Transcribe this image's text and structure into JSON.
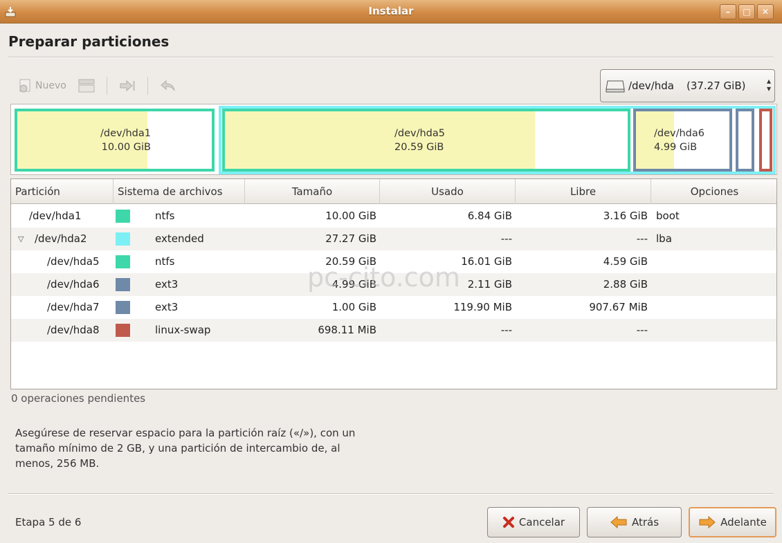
{
  "window": {
    "title": "Instalar"
  },
  "page": {
    "title": "Preparar particiones"
  },
  "toolbar": {
    "new_label": "Nuevo"
  },
  "disk": {
    "name": "/dev/hda",
    "size": "(37.27 GiB)"
  },
  "partition_bar": [
    {
      "name": "/dev/hda1",
      "size": "10.00 GiB"
    },
    {
      "name": "/dev/hda5",
      "size": "20.59 GiB"
    },
    {
      "name": "/dev/hda6",
      "size": "4.99 GiB"
    }
  ],
  "table": {
    "headers": [
      "Partición",
      "Sistema de archivos",
      "Tamaño",
      "Usado",
      "Libre",
      "Opciones"
    ],
    "rows": [
      {
        "partition": "/dev/hda1",
        "fs": "ntfs",
        "size": "10.00 GiB",
        "used": "6.84 GiB",
        "free": "3.16 GiB",
        "options": "boot",
        "color": "#3ed7a9"
      },
      {
        "partition": "/dev/hda2",
        "fs": "extended",
        "size": "27.27 GiB",
        "used": "---",
        "free": "---",
        "options": "lba",
        "color": "#7cf0f5"
      },
      {
        "partition": "/dev/hda5",
        "fs": "ntfs",
        "size": "20.59 GiB",
        "used": "16.01 GiB",
        "free": "4.59 GiB",
        "options": "",
        "color": "#3ed7a9"
      },
      {
        "partition": "/dev/hda6",
        "fs": "ext3",
        "size": "4.99 GiB",
        "used": "2.11 GiB",
        "free": "2.88 GiB",
        "options": "",
        "color": "#6f89a8"
      },
      {
        "partition": "/dev/hda7",
        "fs": "ext3",
        "size": "1.00 GiB",
        "used": "119.90 MiB",
        "free": "907.67 MiB",
        "options": "",
        "color": "#6f89a8"
      },
      {
        "partition": "/dev/hda8",
        "fs": "linux-swap",
        "size": "698.11 MiB",
        "used": "---",
        "free": "---",
        "options": "",
        "color": "#c05a4d"
      }
    ]
  },
  "watermark": "pc-cito.com",
  "status": {
    "pending": "0 operaciones pendientes"
  },
  "info": {
    "text": "Asegúrese de reservar espacio para la partición raíz («/»), con un tamaño mínimo de 2 GB, y una partición de intercambio de, al menos, 256 MB."
  },
  "footer": {
    "step": "Etapa 5 de 6",
    "cancel_label": "Cancelar",
    "back_label": "Atrás",
    "next_label": "Adelante"
  }
}
